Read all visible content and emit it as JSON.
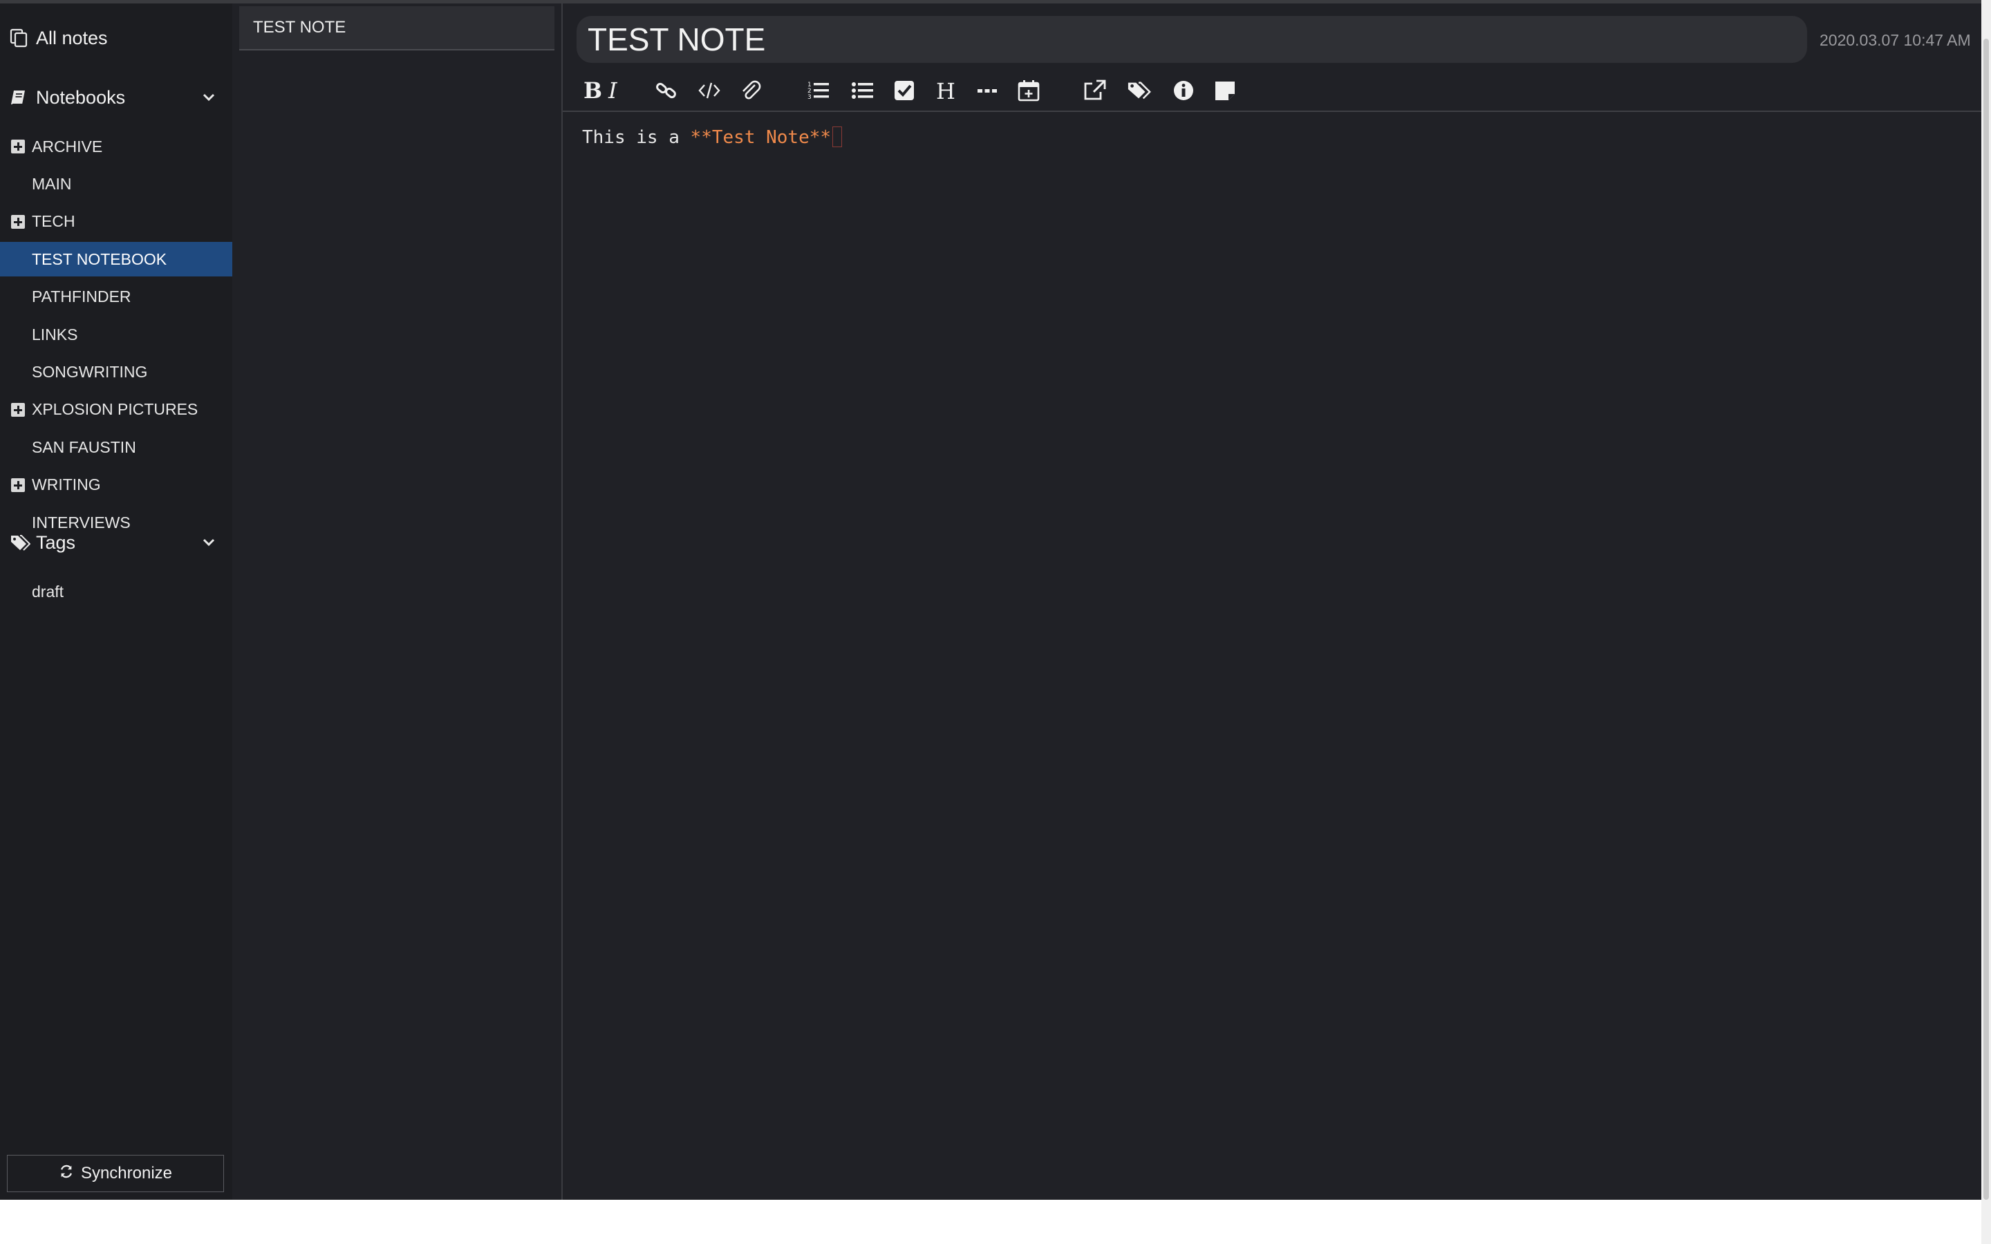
{
  "sidebar": {
    "all_notes": "All notes",
    "notebooks_heading": "Notebooks",
    "notebooks": [
      {
        "label": "ARCHIVE",
        "expandable": true
      },
      {
        "label": "MAIN",
        "expandable": false
      },
      {
        "label": "TECH",
        "expandable": true
      },
      {
        "label": "TEST NOTEBOOK",
        "expandable": false,
        "active": true
      },
      {
        "label": "PATHFINDER",
        "expandable": false
      },
      {
        "label": "LINKS",
        "expandable": false
      },
      {
        "label": "SONGWRITING",
        "expandable": false
      },
      {
        "label": "XPLOSION PICTURES",
        "expandable": true
      },
      {
        "label": "SAN FAUSTIN",
        "expandable": false
      },
      {
        "label": "WRITING",
        "expandable": true
      },
      {
        "label": "INTERVIEWS",
        "expandable": false
      }
    ],
    "tags_heading": "Tags",
    "tags": [
      "draft"
    ],
    "sync_label": "Synchronize"
  },
  "note_list": {
    "items": [
      {
        "title": "TEST NOTE"
      }
    ]
  },
  "editor": {
    "title_value": "TEST NOTE",
    "timestamp": "2020.03.07 10:47 AM",
    "body_plain": "This is a ",
    "body_bold": "**Test Note**",
    "toolbar_icons": [
      "bold-icon",
      "italic-icon",
      "link-icon",
      "code-icon",
      "attachment-icon",
      "numbered-list-icon",
      "bullet-list-icon",
      "checkbox-icon",
      "heading-icon",
      "horizontal-rule-icon",
      "calendar-icon",
      "external-link-icon",
      "tags-icon",
      "info-icon",
      "sticky-note-icon"
    ]
  },
  "colors": {
    "accent_active": "#1f4a80",
    "markdown_bold": "#f08a4b",
    "background": "#202126",
    "sidebar": "#1c1d21"
  }
}
